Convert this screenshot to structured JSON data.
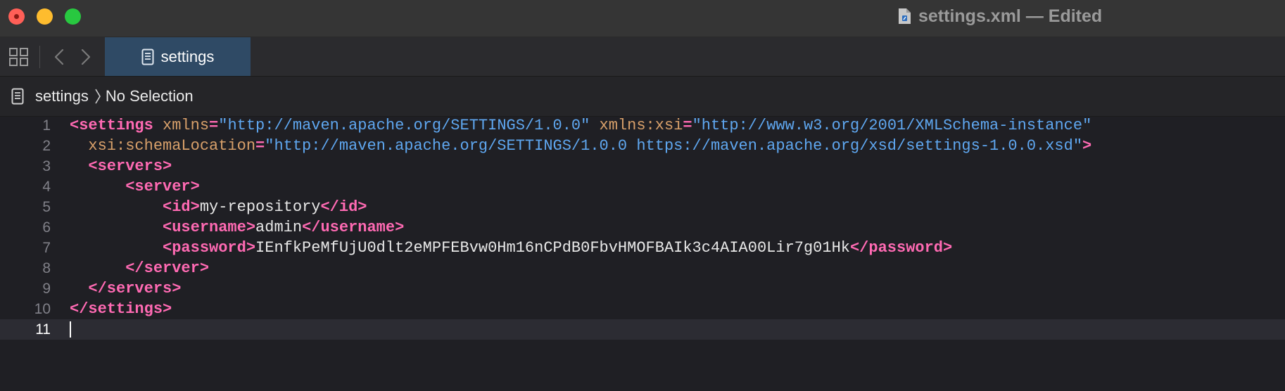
{
  "window": {
    "title": "settings.xml — Edited"
  },
  "tabbar": {
    "active_tab_label": "settings"
  },
  "jumpbar": {
    "file": "settings",
    "selection": "No Selection"
  },
  "colors": {
    "tag": "#ff6ab3",
    "attribute": "#d8a06a",
    "string": "#5fa7f0",
    "text": "#e8e8e8",
    "tab_active": "#2f4a65",
    "close": "#ff5f57",
    "minimize": "#febc2e",
    "zoom": "#28c840"
  },
  "icons": {
    "grid": "grid-icon",
    "back": "chevron-left-icon",
    "forward": "chevron-right-icon",
    "document": "document-icon"
  },
  "editor": {
    "current_line": 11,
    "lines": [
      {
        "number": "1",
        "tokens": [
          {
            "t": "tag",
            "v": "<settings "
          },
          {
            "t": "attr",
            "v": "xmlns"
          },
          {
            "t": "tag",
            "v": "="
          },
          {
            "t": "str",
            "v": "\"http://maven.apache.org/SETTINGS/1.0.0\""
          },
          {
            "t": "attr",
            "v": " xmlns:xsi"
          },
          {
            "t": "tag",
            "v": "="
          },
          {
            "t": "str",
            "v": "\"http://www.w3.org/2001/XMLSchema-instance\""
          }
        ]
      },
      {
        "number": "2",
        "tokens": [
          {
            "t": "attr",
            "v": "  xsi:schemaLocation"
          },
          {
            "t": "tag",
            "v": "="
          },
          {
            "t": "str",
            "v": "\"http://maven.apache.org/SETTINGS/1.0.0 https://maven.apache.org/xsd/settings-1.0.0.xsd\""
          },
          {
            "t": "tag",
            "v": ">"
          }
        ]
      },
      {
        "number": "3",
        "tokens": [
          {
            "t": "tag",
            "v": "  <servers>"
          }
        ]
      },
      {
        "number": "4",
        "tokens": [
          {
            "t": "tag",
            "v": "      <server>"
          }
        ]
      },
      {
        "number": "5",
        "tokens": [
          {
            "t": "tag",
            "v": "          <id>"
          },
          {
            "t": "txt",
            "v": "my-repository"
          },
          {
            "t": "tag",
            "v": "</id>"
          }
        ]
      },
      {
        "number": "6",
        "tokens": [
          {
            "t": "tag",
            "v": "          <username>"
          },
          {
            "t": "txt",
            "v": "admin"
          },
          {
            "t": "tag",
            "v": "</username>"
          }
        ]
      },
      {
        "number": "7",
        "tokens": [
          {
            "t": "tag",
            "v": "          <password>"
          },
          {
            "t": "txt",
            "v": "IEnfkPeMfUjU0dlt2eMPFEBvw0Hm16nCPdB0FbvHMOFBAIk3c4AIA00Lir7g01Hk"
          },
          {
            "t": "tag",
            "v": "</password>"
          }
        ]
      },
      {
        "number": "8",
        "tokens": [
          {
            "t": "tag",
            "v": "      </server>"
          }
        ]
      },
      {
        "number": "9",
        "tokens": [
          {
            "t": "tag",
            "v": "  </servers>"
          }
        ]
      },
      {
        "number": "10",
        "tokens": [
          {
            "t": "tag",
            "v": "</settings>"
          }
        ]
      },
      {
        "number": "11",
        "tokens": []
      }
    ]
  }
}
